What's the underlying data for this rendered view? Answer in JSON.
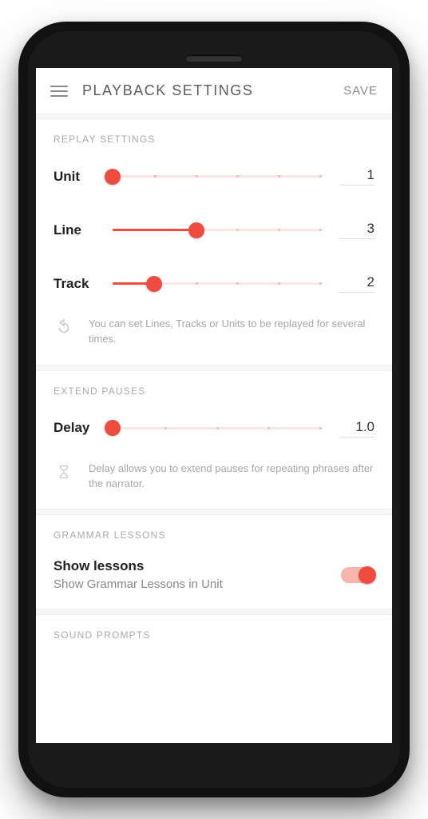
{
  "appbar": {
    "title": "PLAYBACK SETTINGS",
    "save": "SAVE"
  },
  "replay": {
    "header": "REPLAY SETTINGS",
    "rows": [
      {
        "label": "Unit",
        "value": "1",
        "percent": 0
      },
      {
        "label": "Line",
        "value": "3",
        "percent": 40
      },
      {
        "label": "Track",
        "value": "2",
        "percent": 20
      }
    ],
    "hint": "You can set Lines, Tracks or Units to be replayed for several times."
  },
  "extend": {
    "header": "EXTEND PAUSES",
    "row": {
      "label": "Delay",
      "value": "1.0",
      "percent": 0
    },
    "hint": "Delay allows you to extend pauses for repeating phrases after the narrator."
  },
  "grammar": {
    "header": "GRAMMAR LESSONS",
    "title": "Show lessons",
    "subtitle": "Show Grammar Lessons in Unit",
    "on": true
  },
  "sound": {
    "header": "SOUND PROMPTS"
  }
}
